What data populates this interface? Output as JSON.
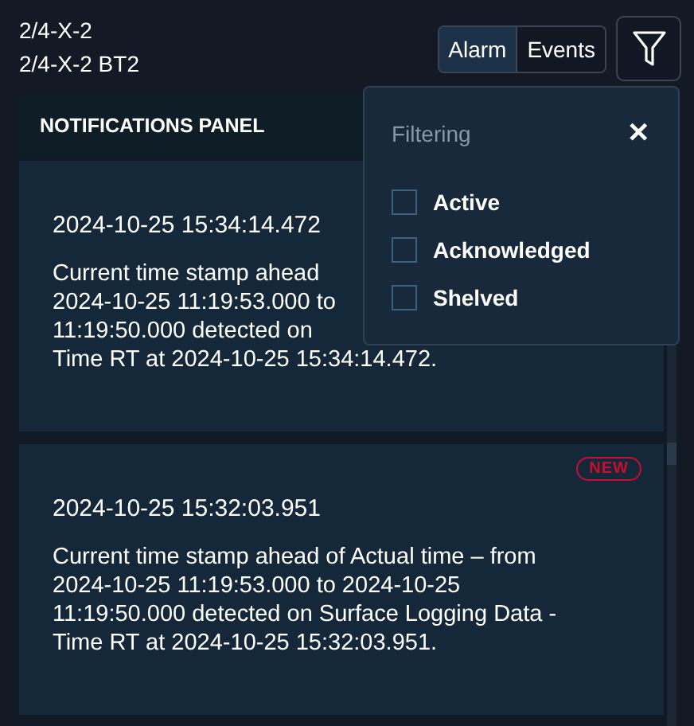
{
  "header": {
    "title": "2/4-X-2",
    "subtitle": "2/4-X-2 BT2"
  },
  "view_toggle": [
    {
      "label": "Alarm",
      "selected": true
    },
    {
      "label": "Events",
      "selected": false
    }
  ],
  "panel": {
    "title": "NOTIFICATIONS PANEL"
  },
  "notifications": [
    {
      "timestamp": "2024-10-25 15:34:14.472",
      "message_lines": [
        "Current time stamp ahead",
        "2024-10-25 11:19:53.000 to",
        "11:19:50.000 detected on",
        "Time RT at 2024-10-25 15:34:14.472."
      ]
    },
    {
      "badge": "NEW",
      "timestamp": "2024-10-25 15:32:03.951",
      "message_lines": [
        "Current time stamp ahead of Actual time – from",
        "2024-10-25 11:19:53.000 to 2024-10-25",
        "11:19:50.000 detected on Surface Logging Data -",
        "Time RT at 2024-10-25 15:32:03.951."
      ]
    }
  ],
  "filter_popover": {
    "title": "Filtering",
    "close": "✕",
    "options": [
      {
        "label": "Active",
        "checked": false
      },
      {
        "label": "Acknowledged",
        "checked": false
      },
      {
        "label": "Shelved",
        "checked": false
      }
    ]
  }
}
